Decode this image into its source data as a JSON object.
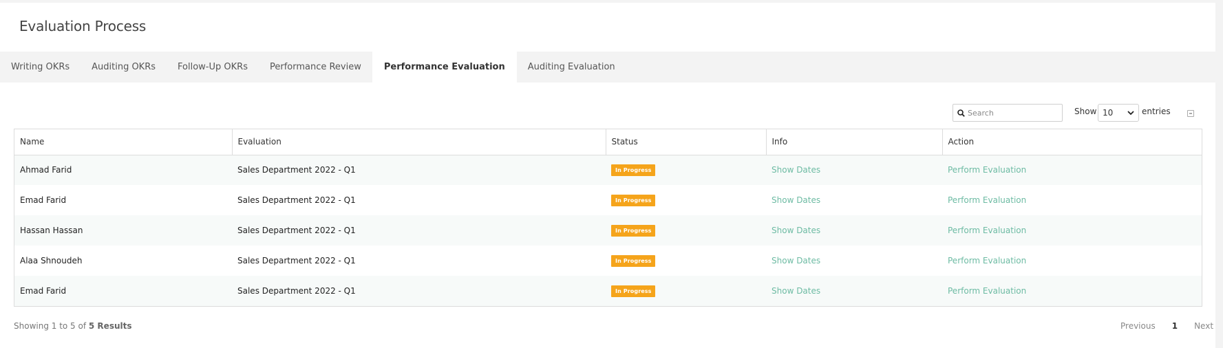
{
  "page": {
    "title": "Evaluation Process"
  },
  "tabs": [
    {
      "label": "Writing OKRs"
    },
    {
      "label": "Auditing OKRs"
    },
    {
      "label": "Follow-Up OKRs"
    },
    {
      "label": "Performance Review"
    },
    {
      "label": "Performance Evaluation",
      "active": true
    },
    {
      "label": "Auditing Evaluation"
    }
  ],
  "toolbar": {
    "search_placeholder": "Search",
    "show_label": "Show",
    "page_size": "10",
    "entries_label": "entries"
  },
  "table": {
    "columns": [
      "Name",
      "Evaluation",
      "Status",
      "Info",
      "Action"
    ],
    "rows": [
      {
        "name": "Ahmad Farid",
        "evaluation": "Sales Department 2022 - Q1",
        "status": "In Progress",
        "info": "Show Dates",
        "action": "Perform Evaluation"
      },
      {
        "name": "Emad Farid",
        "evaluation": "Sales Department 2022 - Q1",
        "status": "In Progress",
        "info": "Show Dates",
        "action": "Perform Evaluation"
      },
      {
        "name": "Hassan Hassan",
        "evaluation": "Sales Department 2022 - Q1",
        "status": "In Progress",
        "info": "Show Dates",
        "action": "Perform Evaluation"
      },
      {
        "name": "Alaa Shnoudeh",
        "evaluation": "Sales Department 2022 - Q1",
        "status": "In Progress",
        "info": "Show Dates",
        "action": "Perform Evaluation"
      },
      {
        "name": "Emad Farid",
        "evaluation": "Sales Department 2022 - Q1",
        "status": "In Progress",
        "info": "Show Dates",
        "action": "Perform Evaluation"
      }
    ]
  },
  "footer": {
    "showing_text": "Showing 1 to 5 of",
    "results_text": "5 Results",
    "prev_label": "Previous",
    "current_page": "1",
    "next_label": "Next"
  },
  "colors": {
    "status_badge": "#f5a41b",
    "link": "#6dbba3"
  },
  "icons": [
    "search-icon",
    "chevron-down-icon",
    "export-icon"
  ]
}
